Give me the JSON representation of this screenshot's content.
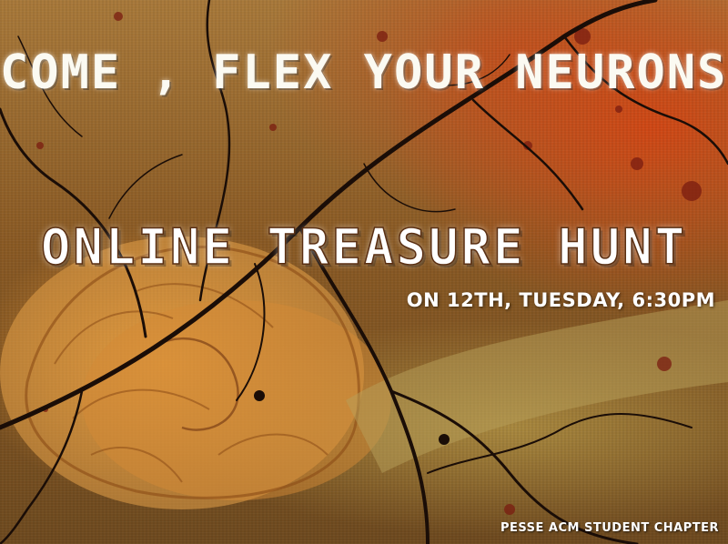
{
  "poster": {
    "headline": "COME , FLEX YOUR NEURONS!",
    "event_title": "ONLINE TREASURE HUNT",
    "event_date": "ON 12TH, TUESDAY, 6:30PM",
    "organizer": "PESSE ACM STUDENT CHAPTER"
  },
  "colors": {
    "background_warm": "#a8793a",
    "accent_orange": "#d2461a",
    "brain": "#e3a048",
    "branches": "#1a0d07",
    "text": "#ffffff"
  },
  "illustrations": [
    "brain-illustration",
    "neuron-branches",
    "paint-splatter"
  ]
}
